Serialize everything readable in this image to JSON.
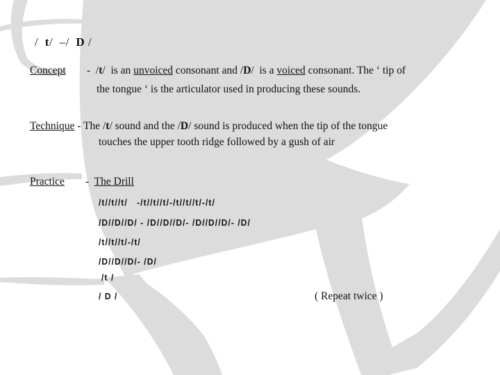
{
  "title": {
    "t": "t",
    "dash": "–",
    "d": "D"
  },
  "concept": {
    "label": "Concept",
    "dash": "-",
    "t_sym": "t",
    "part1": "is an",
    "unvoiced": "unvoiced",
    "part2": "consonant and",
    "d_sym": "D",
    "part3": "is a",
    "voiced": "voiced",
    "part4": "consonant.  The ‘ tip of",
    "line2": "the tongue ‘ is the articulator used in producing these sounds."
  },
  "technique": {
    "label": "Technique",
    "part1": "- The",
    "t_sym": "t",
    "part2": "sound and the",
    "d_sym": "D",
    "part3": "sound is produced when the tip of the tongue",
    "line2": "touches the upper tooth ridge followed by a gush of air"
  },
  "practice": {
    "label": "Practice",
    "dash": "-",
    "drill_title": "The Drill",
    "lines": [
      "/t//t//t/   -/t//t//t/-/t//t//t/-/t/",
      "/D//D//D/ - /D//D//D/- /D//D//D/- /D/",
      "/t//t//t/-/t/",
      "/D//D//D/- /D/",
      "/t /",
      "/ D /"
    ],
    "repeat_note": "( Repeat twice )"
  }
}
